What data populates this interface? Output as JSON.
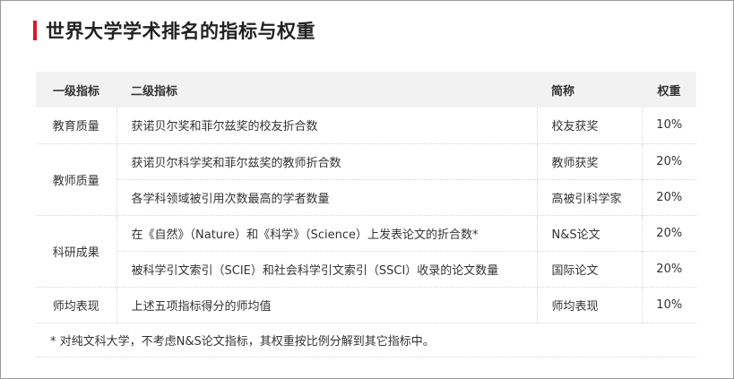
{
  "title": "世界大学学术排名的指标与权重",
  "table": {
    "headers": [
      "一级指标",
      "二级指标",
      "简称",
      "权重"
    ],
    "rows": [
      {
        "primary": "教育质量",
        "secondary": "获诺贝尔奖和菲尔兹奖的校友折合数",
        "abbr": "校友获奖",
        "weight": "10%"
      },
      {
        "primary": "教师质量",
        "secondary": "获诺贝尔科学奖和菲尔兹奖的教师折合数",
        "abbr": "教师获奖",
        "weight": "20%"
      },
      {
        "primary": "",
        "secondary": "各学科领域被引用次数最高的学者数量",
        "abbr": "高被引科学家",
        "weight": "20%"
      },
      {
        "primary": "科研成果",
        "secondary": "在《自然》（Nature）和《科学》（Science）上发表论文的折合数*",
        "abbr": "N&S论文",
        "weight": "20%"
      },
      {
        "primary": "",
        "secondary": "被科学引文索引（SCIE）和社会科学引文索引（SSCI）收录的论文数量",
        "abbr": "国际论文",
        "weight": "20%"
      },
      {
        "primary": "师均表现",
        "secondary": "上述五项指标得分的师均值",
        "abbr": "师均表现",
        "weight": "10%"
      }
    ]
  },
  "note": "* 对纯文科大学，不考虑N&S论文指标，其权重按比例分解到其它指标中。",
  "colors": {
    "accent": "#d7192a",
    "header_bg": "#f2f2f2",
    "text": "#333333"
  }
}
